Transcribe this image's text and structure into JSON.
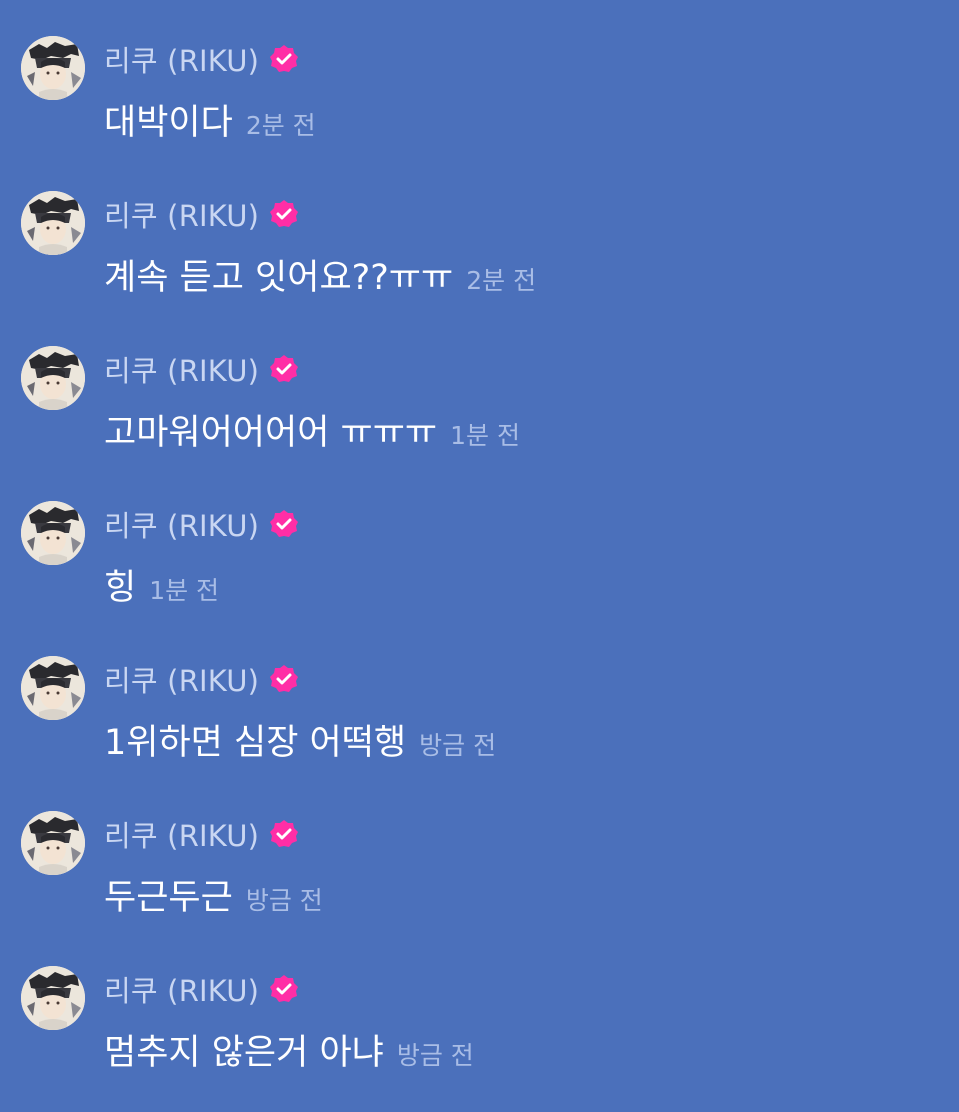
{
  "colors": {
    "background": "#4b70bb",
    "username": "#c9d6f2",
    "message": "#ffffff",
    "timestamp": "#a9bde6",
    "verified_badge": "#ff2ea6"
  },
  "icons": {
    "avatar": "profile-photo",
    "badge": "verified-check-icon"
  },
  "messages": [
    {
      "username": "리쿠 (RIKU)",
      "text": "대박이다",
      "time": "2분 전"
    },
    {
      "username": "리쿠 (RIKU)",
      "text": "계속 듣고 잇어요??ㅠㅠ",
      "time": "2분 전"
    },
    {
      "username": "리쿠 (RIKU)",
      "text": "고마워어어어어 ㅠㅠㅠ",
      "time": "1분 전"
    },
    {
      "username": "리쿠 (RIKU)",
      "text": "힝",
      "time": "1분 전"
    },
    {
      "username": "리쿠 (RIKU)",
      "text": "1위하면 심장 어떡행",
      "time": "방금 전"
    },
    {
      "username": "리쿠 (RIKU)",
      "text": "두근두근",
      "time": "방금 전"
    },
    {
      "username": "리쿠 (RIKU)",
      "text": "멈추지 않은거 아냐",
      "time": "방금 전"
    }
  ]
}
